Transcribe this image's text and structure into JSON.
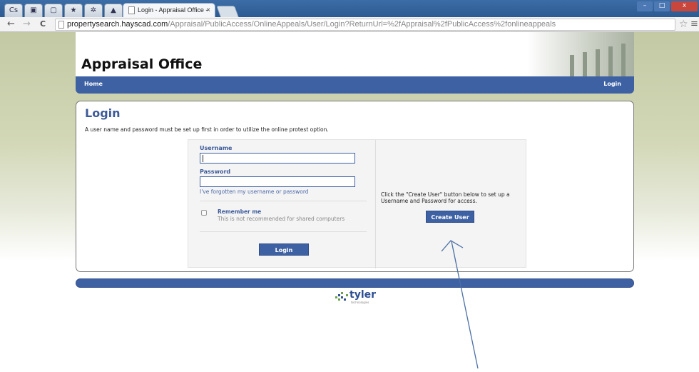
{
  "browser": {
    "tab_pins": [
      "Cs",
      "▣",
      "▢",
      "★",
      "✲",
      "▲"
    ],
    "active_tab": {
      "title": "Login - Appraisal Office -",
      "close": "×"
    },
    "nav": {
      "back": "←",
      "forward": "→",
      "reload": "C"
    },
    "url": {
      "host": "propertysearch.hayscad.com",
      "path": "/Appraisal/PublicAccess/OnlineAppeals/User/Login?ReturnUrl=%2fAppraisal%2fPublicAccess%2fonlineappeals"
    },
    "bookmark_icon": "☆",
    "menu_icon": "≡",
    "window_controls": {
      "minimize": "–",
      "maximize": "□",
      "close": "x"
    }
  },
  "site": {
    "title": "Appraisal Office",
    "nav": {
      "home": "Home",
      "login": "Login"
    }
  },
  "login": {
    "heading": "Login",
    "intro": "A user name and password must be set up first in order to utilize the online protest option.",
    "username_label": "Username",
    "username_value": "",
    "password_label": "Password",
    "password_value": "",
    "forgot_link": "I've forgotten my username or password",
    "remember_label": "Remember me",
    "remember_checked": false,
    "remember_note": "This is not recommended for shared computers",
    "login_button": "Login"
  },
  "create": {
    "text": "Click the \"Create User\" button below to set up a Username and Password for access.",
    "button": "Create User"
  },
  "footer": {
    "logo_text": "tyler",
    "logo_sub": "technologies"
  },
  "colors": {
    "brand_blue": "#3e61a3",
    "heading_blue": "#3d5b99",
    "arrow": "#4a6fa5"
  }
}
